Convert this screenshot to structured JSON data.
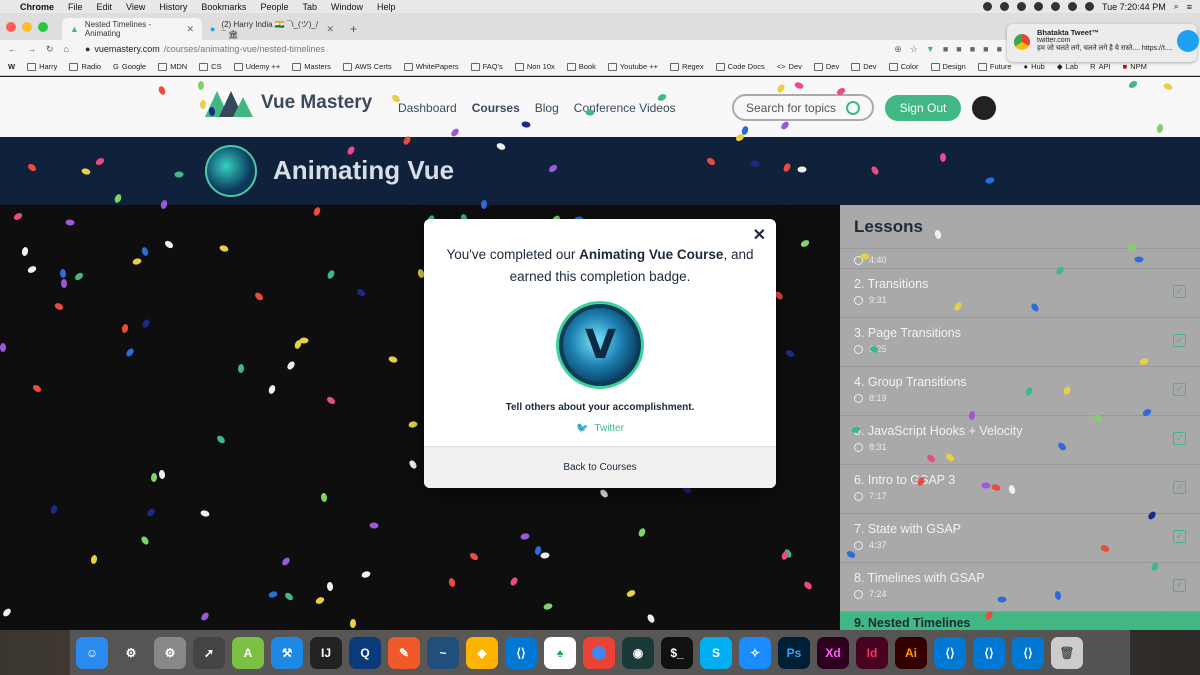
{
  "menubar": {
    "app": "Chrome",
    "items": [
      "File",
      "Edit",
      "View",
      "History",
      "Bookmarks",
      "People",
      "Tab",
      "Window",
      "Help"
    ],
    "clock": "Tue 7:20:44 PM"
  },
  "tabs": [
    {
      "title": "Nested Timelines - Animating"
    },
    {
      "title": "(2) Harry India 🇮🇳 ¯\\_(ツ)_/¯ 🏛"
    }
  ],
  "address": {
    "host": "vuemastery.com",
    "path": "/courses/animating-vue/nested-timelines"
  },
  "bookmarks": [
    "Harry",
    "Radio",
    "Google",
    "MDN",
    "CS",
    "Udemy ++",
    "Masters",
    "AWS Certs",
    "WhitePapers",
    "FAQ's",
    "Non 10x",
    "Book",
    "Youtube ++",
    "Regex",
    "Code Docs",
    "Dev",
    "Dev",
    "Dev",
    "Color",
    "Design",
    "Future",
    "Hub",
    "Lab",
    "API",
    "NPM"
  ],
  "notification": {
    "title": "Bhatakta Tweet™",
    "source": "twitter.com",
    "body": "हम जो चलते लगे, चलने लगे है ये रास्ते.... https://t...."
  },
  "site": {
    "brand": "Vue Mastery",
    "nav": [
      "Dashboard",
      "Courses",
      "Blog",
      "Conference Videos"
    ],
    "search_placeholder": "Search for topics",
    "signout": "Sign Out",
    "course_title": "Animating Vue"
  },
  "lessons": {
    "heading": "Lessons",
    "partial_duration": "4:40",
    "items": [
      {
        "title": "2. Transitions",
        "duration": "9:31"
      },
      {
        "title": "3. Page Transitions",
        "duration": "6:25"
      },
      {
        "title": "4. Group Transitions",
        "duration": "8:19"
      },
      {
        "title": "5. JavaScript Hooks + Velocity",
        "duration": "8:31"
      },
      {
        "title": "6. Intro to GSAP 3",
        "duration": "7:17"
      },
      {
        "title": "7. State with GSAP",
        "duration": "4:37"
      },
      {
        "title": "8. Timelines with GSAP",
        "duration": "7:24"
      }
    ],
    "current": "9. Nested Timelines"
  },
  "modal": {
    "msg_pre": "You've completed our ",
    "msg_course": "Animating Vue Course",
    "msg_post": ", and earned this completion badge.",
    "tell": "Tell others about your accomplishment.",
    "twitter": "Twitter",
    "back": "Back to Courses"
  },
  "colors": {
    "accent": "#41b883",
    "banner": "#10213b"
  }
}
